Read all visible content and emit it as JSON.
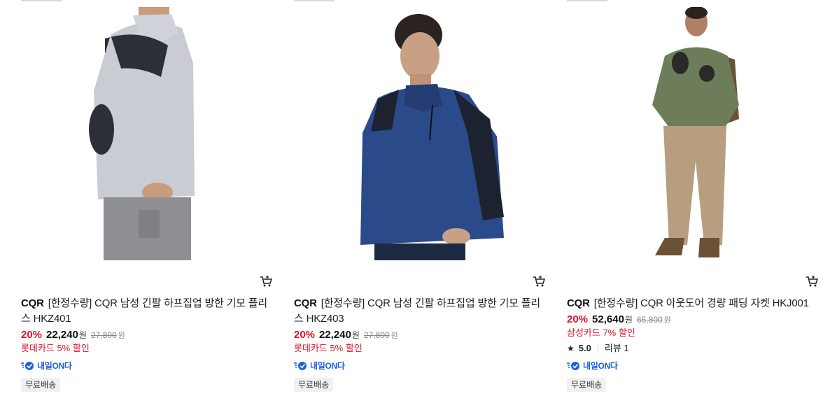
{
  "products": [
    {
      "brand": "CQR",
      "name": "[한정수량] CQR 남성 긴팔 하프집업 방한 기모 플리스 HKZ401",
      "discount": "20%",
      "price": "22,240",
      "currency": "원",
      "original_price": "27,800",
      "promo": "롯데카드 5% 할인",
      "shipping_tag": "내일ON다",
      "badge": "무료배송",
      "colors": {
        "body": "#c9ccd2",
        "panel": "#2c2f36",
        "pants": "#8d8f93"
      }
    },
    {
      "brand": "CQR",
      "name": "[한정수량] CQR 남성 긴팔 하프집업 방한 기모 플리스 HKZ403",
      "discount": "20%",
      "price": "22,240",
      "currency": "원",
      "original_price": "27,800",
      "promo": "롯데카드 5% 할인",
      "shipping_tag": "내일ON다",
      "badge": "무료배송",
      "colors": {
        "body": "#2b4a8a",
        "panel": "#1d2230",
        "pants": "#1d2a44"
      }
    },
    {
      "brand": "CQR",
      "name": "[한정수량] CQR 아웃도어 경량 패딩 자켓 HKJ001",
      "discount": "20%",
      "price": "52,640",
      "currency": "원",
      "original_price": "65,800",
      "promo": "삼성카드 7% 할인",
      "rating": "5.0",
      "review_label": "리뷰 1",
      "shipping_tag": "내일ON다",
      "badge": "무료배송",
      "colors": {
        "body": "#6d7d5a",
        "panel": "#6d7d5a",
        "pants": "#b79e7e"
      }
    }
  ]
}
